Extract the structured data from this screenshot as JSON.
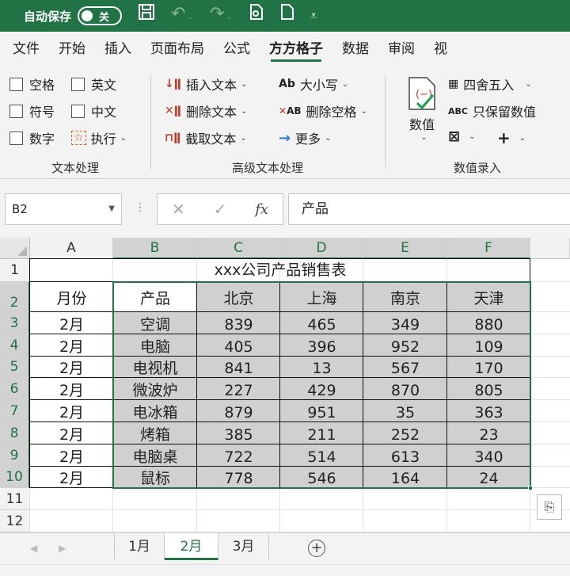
{
  "titlebar": {
    "autosave_label": "自动保存",
    "autosave_state": "关",
    "icons": [
      "save-icon",
      "undo-icon",
      "redo-icon",
      "print-preview-icon",
      "new-file-icon",
      "customize-icon"
    ]
  },
  "ribbon_tabs": [
    {
      "label": "文件"
    },
    {
      "label": "开始"
    },
    {
      "label": "插入"
    },
    {
      "label": "页面布局"
    },
    {
      "label": "公式"
    },
    {
      "label": "方方格子",
      "active": true
    },
    {
      "label": "数据"
    },
    {
      "label": "审阅"
    },
    {
      "label": "视"
    }
  ],
  "ribbon": {
    "text_group": {
      "label": "文本处理",
      "checkboxes": [
        "空格",
        "英文",
        "符号",
        "中文",
        "数字"
      ],
      "execute": "执行"
    },
    "advanced_group": {
      "label": "高级文本处理",
      "insert_text": "插入文本",
      "delete_text": "删除文本",
      "extract_text": "截取文本",
      "case": "大小写",
      "delete_space": "删除空格",
      "more": "更多"
    },
    "number_group": {
      "label": "数值录入",
      "number_btn": "数值",
      "round": "四舍五入",
      "keep_number": "只保留数值",
      "abc_icon": "ABC"
    }
  },
  "formula_bar": {
    "name_box": "B2",
    "fx": "fx",
    "content": "产品"
  },
  "columns": [
    "A",
    "B",
    "C",
    "D",
    "E",
    "F"
  ],
  "rows": [
    "1",
    "2",
    "3",
    "4",
    "5",
    "6",
    "7",
    "8",
    "9",
    "10",
    "11",
    "12"
  ],
  "table": {
    "title": "xxx公司产品销售表",
    "header": [
      "月份",
      "产品",
      "北京",
      "上海",
      "南京",
      "天津"
    ],
    "body": [
      [
        "2月",
        "空调",
        "839",
        "465",
        "349",
        "880"
      ],
      [
        "2月",
        "电脑",
        "405",
        "396",
        "952",
        "109"
      ],
      [
        "2月",
        "电视机",
        "841",
        "13",
        "567",
        "170"
      ],
      [
        "2月",
        "微波炉",
        "227",
        "429",
        "870",
        "805"
      ],
      [
        "2月",
        "电冰箱",
        "879",
        "951",
        "35",
        "363"
      ],
      [
        "2月",
        "烤箱",
        "385",
        "211",
        "252",
        "23"
      ],
      [
        "2月",
        "电脑桌",
        "722",
        "514",
        "613",
        "340"
      ],
      [
        "2月",
        "鼠标",
        "778",
        "546",
        "164",
        "24"
      ]
    ]
  },
  "sheets": [
    {
      "label": "1月"
    },
    {
      "label": "2月",
      "active": true
    },
    {
      "label": "3月"
    }
  ],
  "colors": {
    "accent": "#217346",
    "selection_fill": "#d0d0d0"
  }
}
